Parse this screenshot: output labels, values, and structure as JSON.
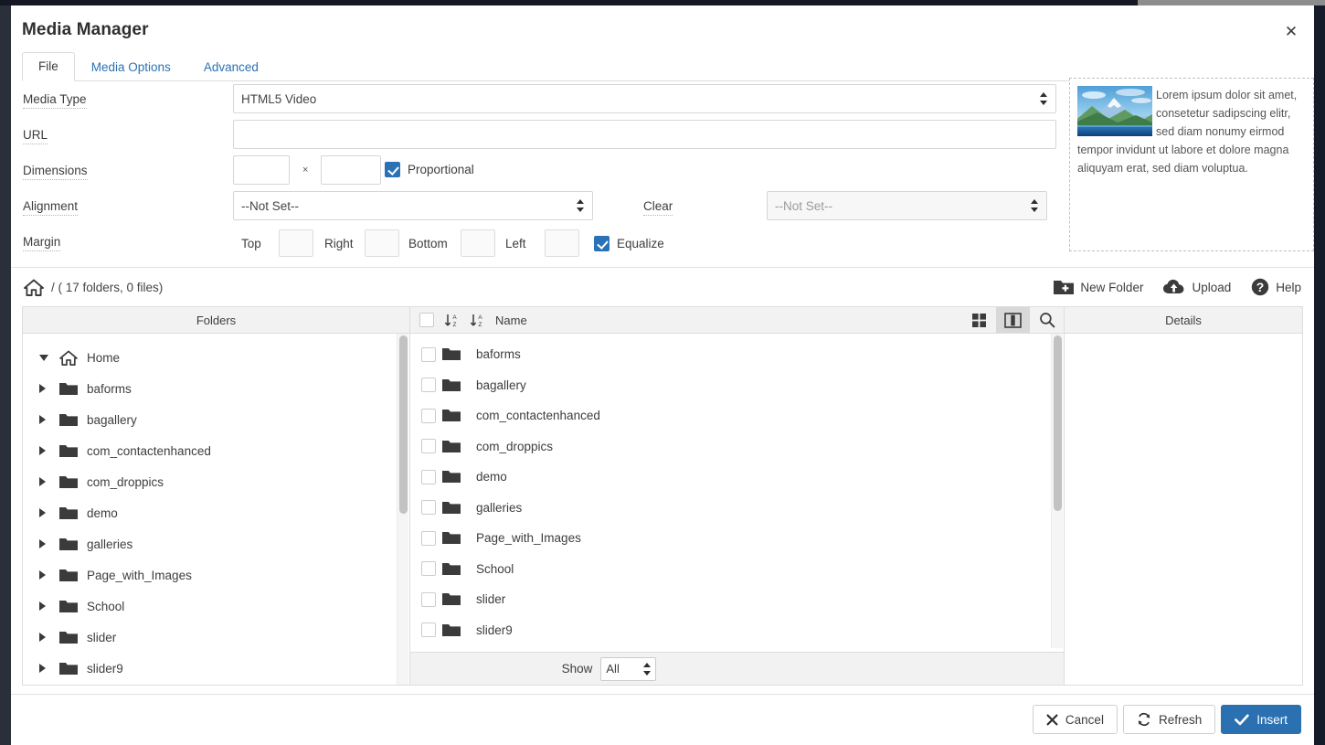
{
  "window": {
    "title": "Media Manager",
    "close_label": "✕"
  },
  "tabs": [
    {
      "label": "File",
      "active": true
    },
    {
      "label": "Media Options",
      "active": false
    },
    {
      "label": "Advanced",
      "active": false
    }
  ],
  "form": {
    "media_type": {
      "label": "Media Type",
      "value": "HTML5 Video"
    },
    "url": {
      "label": "URL",
      "value": "",
      "placeholder": ""
    },
    "dimensions": {
      "label": "Dimensions",
      "width": "",
      "height": "",
      "separator": "×",
      "proportional_label": "Proportional",
      "proportional_checked": true
    },
    "alignment": {
      "label": "Alignment",
      "value": "--Not Set--"
    },
    "clear": {
      "label": "Clear",
      "value": "--Not Set--",
      "disabled": true
    },
    "margin": {
      "label": "Margin",
      "top_label": "Top",
      "top_value": "",
      "right_label": "Right",
      "right_value": "",
      "bottom_label": "Bottom",
      "bottom_value": "",
      "left_label": "Left",
      "left_value": "",
      "equalize_label": "Equalize",
      "equalize_checked": true
    }
  },
  "preview": {
    "text": "Lorem ipsum dolor sit amet, consetetur sadipscing elitr, sed diam nonumy eirmod tempor invidunt ut labore et dolore magna aliquyam erat, sed diam voluptua.",
    "image_alt": "landscape-thumbnail"
  },
  "breadcrumb": {
    "path": "/  ( 17 folders, 0 files)",
    "home_icon": "home-icon"
  },
  "toolbar_actions": [
    {
      "label": "New Folder",
      "icon": "new-folder-icon"
    },
    {
      "label": "Upload",
      "icon": "cloud-upload-icon"
    },
    {
      "label": "Help",
      "icon": "help-circle-icon"
    }
  ],
  "panels": {
    "tree_header": "Folders",
    "files_header": "Name",
    "details_header": "Details"
  },
  "tree": [
    {
      "label": "Home",
      "icon": "home-icon",
      "expanded": true
    },
    {
      "label": "baforms",
      "icon": "folder-icon",
      "expanded": false
    },
    {
      "label": "bagallery",
      "icon": "folder-icon",
      "expanded": false
    },
    {
      "label": "com_contactenhanced",
      "icon": "folder-icon",
      "expanded": false
    },
    {
      "label": "com_droppics",
      "icon": "folder-icon",
      "expanded": false
    },
    {
      "label": "demo",
      "icon": "folder-icon",
      "expanded": false
    },
    {
      "label": "galleries",
      "icon": "folder-icon",
      "expanded": false
    },
    {
      "label": "Page_with_Images",
      "icon": "folder-icon",
      "expanded": false
    },
    {
      "label": "School",
      "icon": "folder-icon",
      "expanded": false
    },
    {
      "label": "slider",
      "icon": "folder-icon",
      "expanded": false
    },
    {
      "label": "slider9",
      "icon": "folder-icon",
      "expanded": false
    }
  ],
  "files": [
    {
      "name": "baforms",
      "icon": "folder-icon",
      "checked": false
    },
    {
      "name": "bagallery",
      "icon": "folder-icon",
      "checked": false
    },
    {
      "name": "com_contactenhanced",
      "icon": "folder-icon",
      "checked": false
    },
    {
      "name": "com_droppics",
      "icon": "folder-icon",
      "checked": false
    },
    {
      "name": "demo",
      "icon": "folder-icon",
      "checked": false
    },
    {
      "name": "galleries",
      "icon": "folder-icon",
      "checked": false
    },
    {
      "name": "Page_with_Images",
      "icon": "folder-icon",
      "checked": false
    },
    {
      "name": "School",
      "icon": "folder-icon",
      "checked": false
    },
    {
      "name": "slider",
      "icon": "folder-icon",
      "checked": false
    },
    {
      "name": "slider9",
      "icon": "folder-icon",
      "checked": false
    }
  ],
  "files_footer": {
    "show_label": "Show",
    "show_value": "All"
  },
  "footer": {
    "cancel": "Cancel",
    "refresh": "Refresh",
    "insert": "Insert"
  },
  "colors": {
    "accent": "#2b71b1",
    "link": "#2a72b5",
    "icon_dark": "#3a3a3a",
    "panel_head": "#f2f2f2"
  }
}
